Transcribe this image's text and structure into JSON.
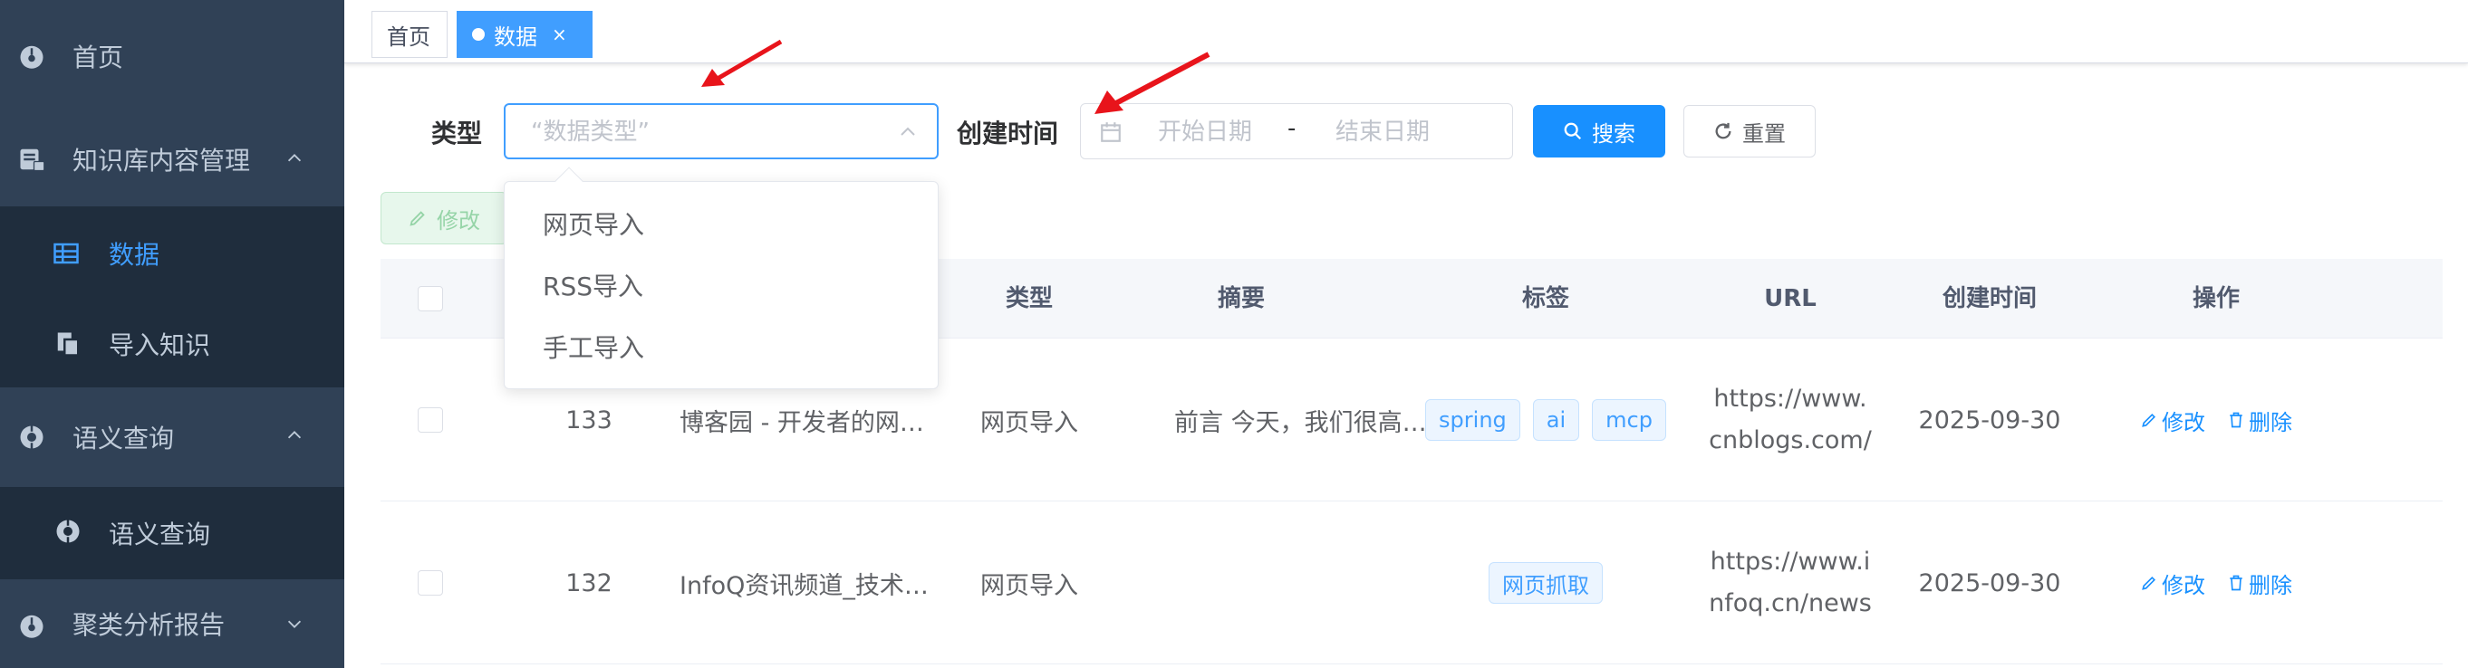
{
  "sidebar": {
    "items": [
      {
        "label": "首页",
        "icon": "dashboard-icon"
      },
      {
        "label": "知识库内容管理",
        "icon": "content-manage-icon"
      },
      {
        "label": "数据",
        "icon": "table-icon"
      },
      {
        "label": "导入知识",
        "icon": "import-doc-icon"
      },
      {
        "label": "语义查询",
        "icon": "semantic-query-icon"
      },
      {
        "label": "语义查询",
        "icon": "query-sub-icon"
      },
      {
        "label": "聚类分析报告",
        "icon": "cluster-report-icon"
      }
    ]
  },
  "tags": {
    "home": "首页",
    "current": "数据",
    "close": "×"
  },
  "search": {
    "type_label": "类型",
    "type_placeholder": "“数据类型”",
    "time_label": "创建时间",
    "start_placeholder": "开始日期",
    "range_separator": "-",
    "end_placeholder": "结束日期",
    "search_button": "搜索",
    "reset_button": "重置"
  },
  "toolbar": {
    "edit_button": "修改"
  },
  "dropdown": {
    "options": [
      "网页导入",
      "RSS导入",
      "手工导入"
    ]
  },
  "table": {
    "headers": {
      "type": "类型",
      "summary": "摘要",
      "tags": "标签",
      "url": "URL",
      "created": "创建时间",
      "actions": "操作"
    },
    "rows": [
      {
        "id": "133",
        "title": "博客园 - 开发者的网…",
        "type": "网页导入",
        "summary": "前言 今天，我们很高…",
        "tags": [
          "spring",
          "ai",
          "mcp"
        ],
        "url": "https://www.cnblogs.com/",
        "created": "2025-09-30",
        "edit": "修改",
        "delete": "删除"
      },
      {
        "id": "132",
        "title": "InfoQ资讯频道_技术…",
        "type": "网页导入",
        "summary": "",
        "tags": [
          "网页抓取"
        ],
        "url": "https://www.infoq.cn/news",
        "created": "2025-09-30",
        "edit": "修改",
        "delete": "删除"
      }
    ]
  },
  "colors": {
    "sidebar_bg": "#304156",
    "sidebar_sub_bg": "#1f2d3d",
    "accent": "#409eff",
    "primary_button": "#1890ff",
    "annotation_arrow": "#e8141b"
  }
}
